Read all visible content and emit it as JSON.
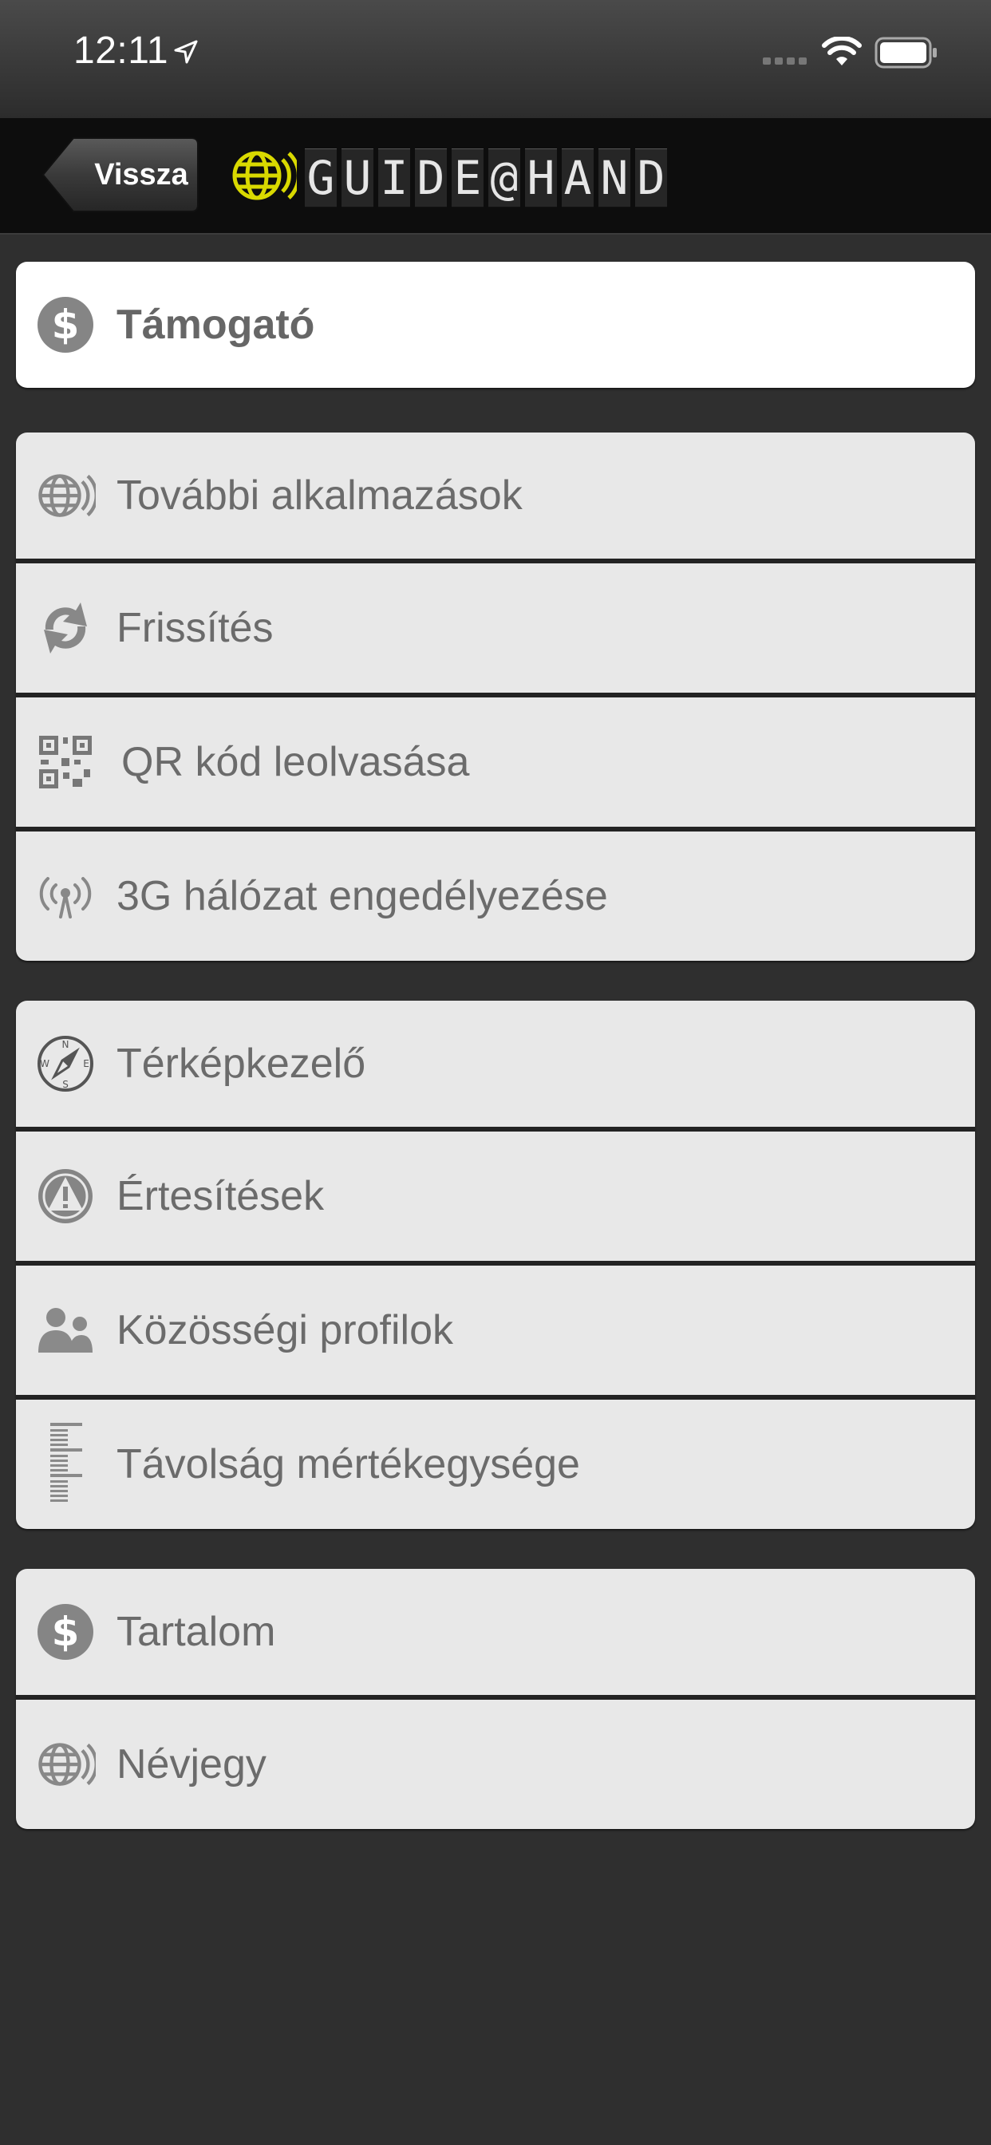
{
  "status_bar": {
    "time": "12:11"
  },
  "nav": {
    "back_label": "Vissza",
    "logo_letters": [
      "G",
      "U",
      "I",
      "D",
      "E",
      "@",
      "H",
      "A",
      "N",
      "D"
    ],
    "logo_accent": "#d9d900"
  },
  "groups": [
    {
      "items": [
        {
          "label": "Támogató",
          "icon": "dollar-icon"
        }
      ]
    },
    {
      "items": [
        {
          "label": "További alkalmazások",
          "icon": "globe-icon"
        },
        {
          "label": "Frissítés",
          "icon": "refresh-icon"
        },
        {
          "label": "QR kód leolvasása",
          "icon": "qr-code-icon"
        },
        {
          "label": "3G hálózat engedélyezése",
          "icon": "antenna-icon"
        }
      ]
    },
    {
      "items": [
        {
          "label": "Térképkezelő",
          "icon": "compass-icon"
        },
        {
          "label": "Értesítések",
          "icon": "warning-icon"
        },
        {
          "label": "Közösségi profilok",
          "icon": "people-icon"
        },
        {
          "label": "Távolság mértékegysége",
          "icon": "ruler-icon"
        }
      ]
    },
    {
      "items": [
        {
          "label": "Tartalom",
          "icon": "dollar-icon"
        },
        {
          "label": "Névjegy",
          "icon": "globe-icon"
        }
      ]
    }
  ]
}
